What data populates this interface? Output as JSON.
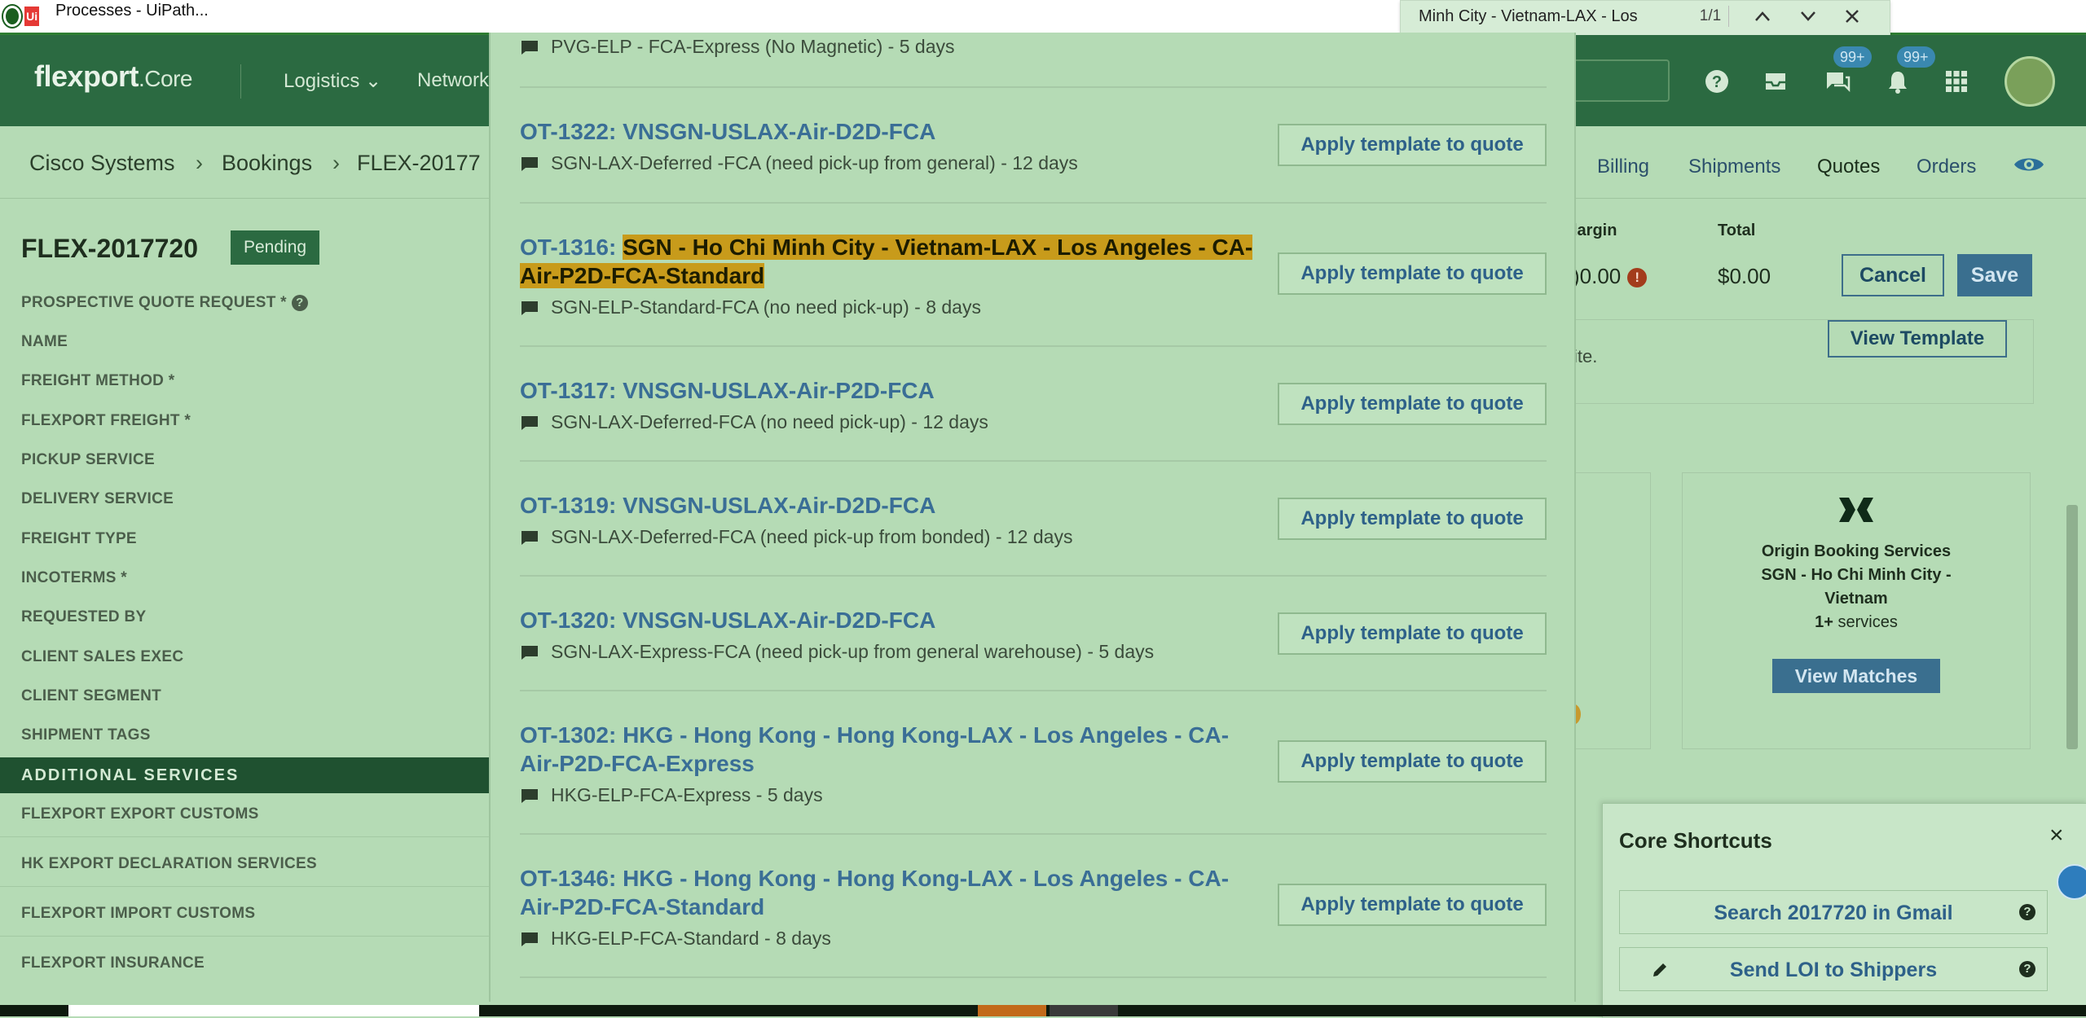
{
  "os": {
    "title": "Processes - UiPath..."
  },
  "find": {
    "query": "Minh City - Vietnam-LAX - Los",
    "count": "1/1"
  },
  "header": {
    "brand": "flexport",
    "brand_suffix": ".Core",
    "nav": [
      "Logistics ⌄",
      "Network"
    ],
    "badges": [
      "99+",
      "99+"
    ]
  },
  "breadcrumb": [
    "Cisco Systems",
    "Bookings",
    "FLEX-20177"
  ],
  "tabs": [
    "Billing",
    "Shipments",
    "Quotes",
    "Orders"
  ],
  "booking": {
    "id": "FLEX-2017720",
    "status": "Pending"
  },
  "fields": [
    "PROSPECTIVE QUOTE REQUEST *",
    "NAME",
    "FREIGHT METHOD *",
    "FLEXPORT FREIGHT *",
    "PICKUP SERVICE",
    "DELIVERY SERVICE",
    "FREIGHT TYPE",
    "INCOTERMS *",
    "REQUESTED BY",
    "CLIENT SALES EXEC",
    "CLIENT SEGMENT",
    "SHIPMENT TAGS"
  ],
  "section": "ADDITIONAL SERVICES",
  "extra_fields": [
    "FLEXPORT EXPORT CUSTOMS",
    "HK EXPORT DECLARATION SERVICES",
    "FLEXPORT IMPORT CUSTOMS",
    "FLEXPORT INSURANCE"
  ],
  "summary": {
    "margin_label": "largin",
    "margin_value": ")0.00",
    "total_label": "Total",
    "total_value": "$0.00",
    "cancel": "Cancel",
    "save": "Save",
    "view_template": "View Template",
    "note": "ite."
  },
  "origin_card": {
    "title": "Origin Booking Services",
    "line2": "SGN - Ho Chi Minh City -",
    "line3": "Vietnam",
    "count_bold": "1+",
    "count_rest": " services",
    "button": "View Matches"
  },
  "modal": {
    "top_sub": "PVG-ELP - FCA-Express (No Magnetic) - 5 days",
    "apply_label": "Apply template to quote",
    "rows": [
      {
        "id": "OT-1322:",
        "title": "VNSGN-USLAX-Air-D2D-FCA",
        "sub": "SGN-LAX-Deferred -FCA (need pick-up from general) - 12 days"
      },
      {
        "id": "OT-1316:",
        "title": "SGN - Ho Chi Minh City - Vietnam-LAX - Los Angeles - CA-Air-P2D-FCA-Standard",
        "sub": "SGN-ELP-Standard-FCA (no need pick-up) - 8 days"
      },
      {
        "id": "OT-1317:",
        "title": "VNSGN-USLAX-Air-P2D-FCA",
        "sub": "SGN-LAX-Deferred-FCA (no need pick-up) - 12 days"
      },
      {
        "id": "OT-1319:",
        "title": "VNSGN-USLAX-Air-D2D-FCA",
        "sub": "SGN-LAX-Deferred-FCA (need pick-up from bonded) - 12 days"
      },
      {
        "id": "OT-1320:",
        "title": "VNSGN-USLAX-Air-D2D-FCA",
        "sub": "SGN-LAX-Express-FCA (need pick-up from general warehouse) - 5 days"
      },
      {
        "id": "OT-1302:",
        "title": "HKG - Hong Kong - Hong Kong-LAX - Los Angeles - CA-Air-P2D-FCA-Express",
        "sub": "HKG-ELP-FCA-Express - 5 days"
      },
      {
        "id": "OT-1346:",
        "title": "HKG - Hong Kong - Hong Kong-LAX - Los Angeles - CA-Air-P2D-FCA-Standard",
        "sub": "HKG-ELP-FCA-Standard - 8 days"
      }
    ]
  },
  "shortcuts": {
    "title": "Core Shortcuts",
    "items": [
      "Search 2017720 in Gmail",
      "Send LOI to Shippers"
    ]
  }
}
